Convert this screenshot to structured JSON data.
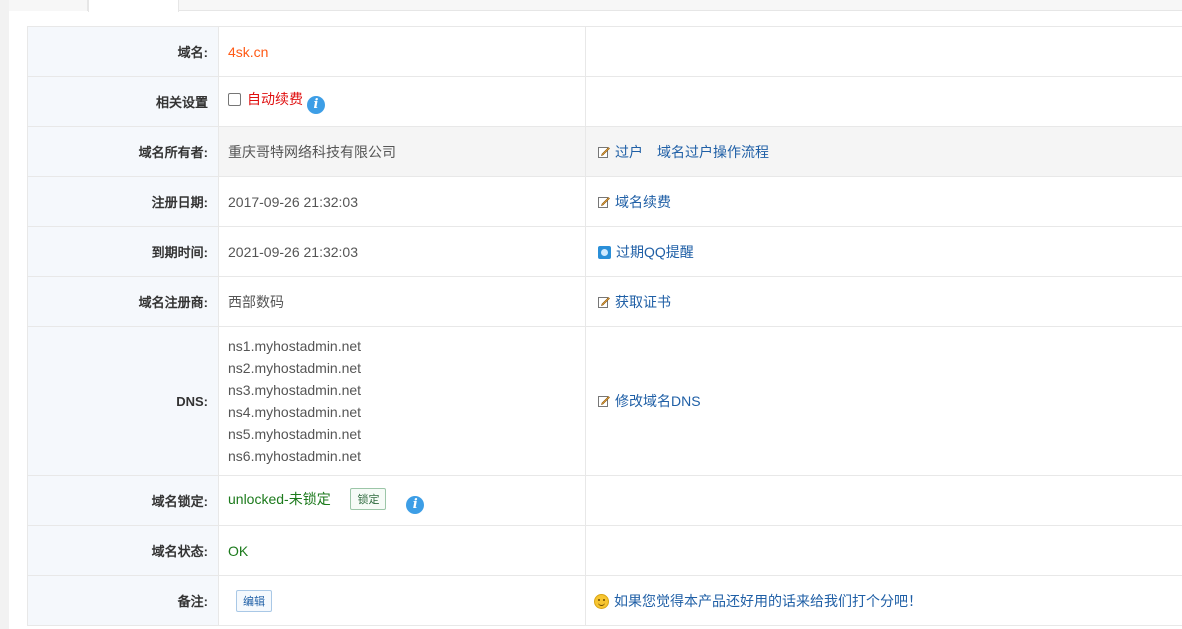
{
  "rows": {
    "domain": {
      "label": "域名:",
      "value": "4sk.cn"
    },
    "settings": {
      "label": "相关设置",
      "checkbox_label": "自动续费"
    },
    "owner": {
      "label": "域名所有者:",
      "value": "重庆哥特网络科技有限公司",
      "action1": "过户",
      "action2": "域名过户操作流程"
    },
    "reg_date": {
      "label": "注册日期:",
      "value": "2017-09-26 21:32:03",
      "action": "域名续费"
    },
    "exp_date": {
      "label": "到期时间:",
      "value": "2021-09-26 21:32:03",
      "action": "过期QQ提醒"
    },
    "registrar": {
      "label": "域名注册商:",
      "value": "西部数码",
      "action": "获取证书"
    },
    "dns": {
      "label": "DNS:",
      "servers": [
        "ns1.myhostadmin.net",
        "ns2.myhostadmin.net",
        "ns3.myhostadmin.net",
        "ns4.myhostadmin.net",
        "ns5.myhostadmin.net",
        "ns6.myhostadmin.net"
      ],
      "action": "修改域名DNS"
    },
    "lock": {
      "label": "域名锁定:",
      "value": "unlocked-未锁定",
      "button": "锁定"
    },
    "status": {
      "label": "域名状态:",
      "value": "OK"
    },
    "remark": {
      "label": "备注:",
      "button": "编辑",
      "feedback": "如果您觉得本产品还好用的话来给我们打个分吧！"
    }
  },
  "colors": {
    "accent_orange": "#ff5a16",
    "link_blue": "#1f5fa6",
    "ok_green": "#1c7a1c",
    "warn_red": "#e01010",
    "info_blue": "#3d9ee6"
  },
  "icons": [
    "info-icon",
    "edit-icon",
    "qq-icon",
    "smile-icon"
  ]
}
